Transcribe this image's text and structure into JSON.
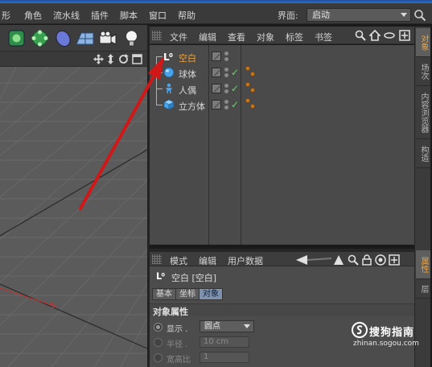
{
  "menubar": {
    "items": [
      "形",
      "角色",
      "流水线",
      "插件",
      "脚本",
      "窗口",
      "帮助"
    ],
    "layout_label": "界面:",
    "layout_value": "启动"
  },
  "object_manager": {
    "menu": [
      "文件",
      "编辑",
      "查看",
      "对象",
      "标签",
      "书签"
    ],
    "objects": [
      {
        "name": "空白",
        "selected": true,
        "icon": "null-object-icon"
      },
      {
        "name": "球体",
        "selected": false,
        "icon": "sphere-icon"
      },
      {
        "name": "人偶",
        "selected": false,
        "icon": "figure-icon"
      },
      {
        "name": "立方体",
        "selected": false,
        "icon": "cube-icon"
      }
    ]
  },
  "side_tabs": {
    "top": [
      "对象",
      "场次",
      "内容浏览器",
      "构造"
    ],
    "bottom": [
      "属性",
      "层"
    ]
  },
  "attributes": {
    "menu": [
      "模式",
      "编辑",
      "用户数据"
    ],
    "object_title": "空白 [空白]",
    "tabs": [
      "基本",
      "坐标",
      "对象"
    ],
    "active_tab": "对象",
    "section_title": "对象属性",
    "display_label": "显示 .",
    "display_value": "圆点",
    "radius_label": "半径 .",
    "radius_value": "10 cm",
    "aspect_label": "宽高比",
    "aspect_value": "1"
  },
  "watermark": {
    "name": "搜狗指南",
    "url": "zhinan.sogou.com"
  },
  "colors": {
    "accent_orange": "#f0a43a",
    "arrow_red": "#d01818",
    "tab_active_blue": "#7f92ad"
  }
}
